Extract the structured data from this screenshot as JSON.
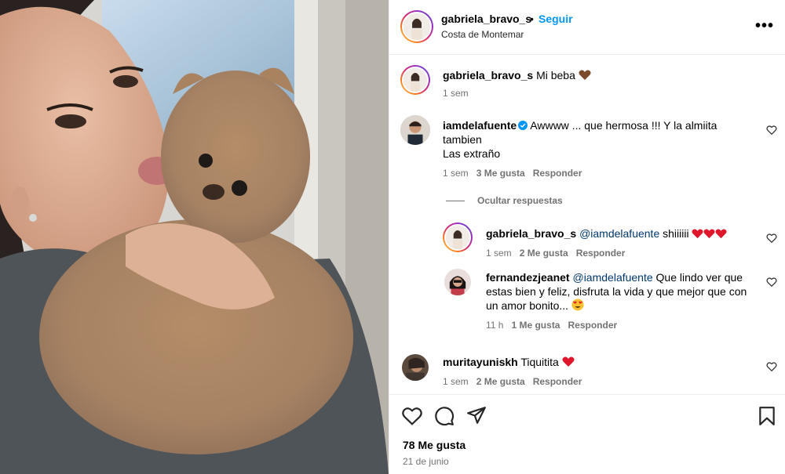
{
  "post": {
    "author": "gabriela_bravo_s",
    "separator": "•",
    "follow_label": "Seguir",
    "location": "Costa de Montemar",
    "more_label": "•••"
  },
  "caption": {
    "user": "gabriela_bravo_s",
    "text": "Mi beba",
    "time": "1 sem"
  },
  "comments": [
    {
      "user": "iamdelafuente",
      "verified": true,
      "line1": "Awwww ... que hermosa !!! Y la almiita",
      "line2": "tambien",
      "line3": "Las extraño",
      "time": "1 sem",
      "likes": "3 Me gusta",
      "reply": "Responder"
    },
    {
      "hide_replies": "Ocultar respuestas"
    },
    {
      "user": "gabriela_bravo_s",
      "mention": "@iamdelafuente",
      "text": "shiiiiii",
      "time": "1 sem",
      "likes": "2 Me gusta",
      "reply": "Responder"
    },
    {
      "user": "fernandezjeanet",
      "mention": "@iamdelafuente",
      "line1": "Que lindo ver que",
      "line2": "estas bien y feliz, disfruta la vida y que mejor que con",
      "line3": "un amor bonito...",
      "time": "11 h",
      "likes": "1 Me gusta",
      "reply": "Responder"
    },
    {
      "user": "muritayuniskh",
      "text": "Tiquitita",
      "time": "1 sem",
      "likes": "2 Me gusta",
      "reply": "Responder"
    }
  ],
  "footer": {
    "likes": "78 Me gusta",
    "date": "21 de junio"
  },
  "icons": {
    "like": "heart-icon",
    "comment": "comment-icon",
    "share": "send-icon",
    "save": "bookmark-icon",
    "verified": "verified-badge-icon"
  },
  "colors": {
    "link_blue": "#0095f6",
    "mention": "#00376b",
    "secondary_text": "#737373",
    "heart_red": "#e0162b",
    "brown_heart": "#7a4a2a"
  }
}
